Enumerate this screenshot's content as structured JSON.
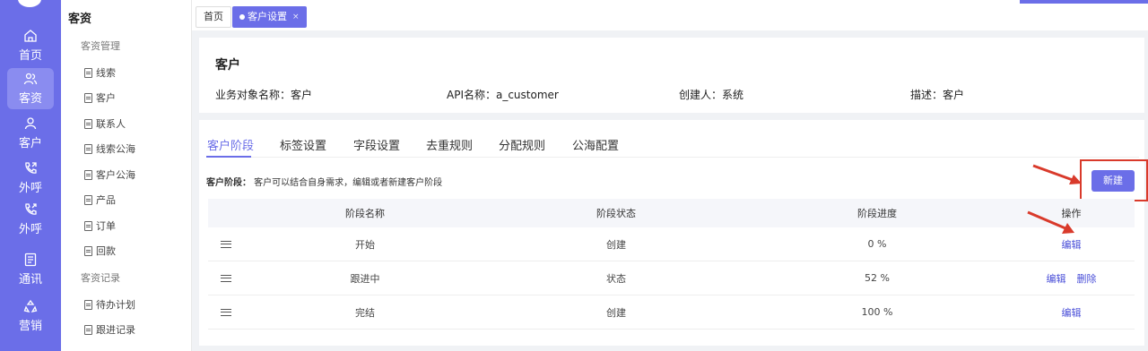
{
  "colors": {
    "brand": "#6b6ee8",
    "highlight_red": "#d93a2b",
    "link": "#4a4fd8"
  },
  "rail": {
    "items": [
      {
        "label": "首页",
        "icon": "home-icon",
        "active": false
      },
      {
        "label": "客资",
        "icon": "users-icon",
        "active": true
      },
      {
        "label": "客户",
        "icon": "user-icon",
        "active": false
      },
      {
        "label": "外呼",
        "icon": "phone-out-icon",
        "active": false
      },
      {
        "label": "外呼",
        "icon": "phone-forward-icon",
        "active": false
      },
      {
        "label": "通讯",
        "icon": "contacts-icon",
        "active": false
      },
      {
        "label": "营销",
        "icon": "recycle-icon",
        "active": false
      }
    ]
  },
  "sidebar": {
    "title": "客资",
    "group1": "客资管理",
    "items1": [
      "线索",
      "客户",
      "联系人",
      "线索公海",
      "客户公海",
      "产品",
      "订单",
      "回款"
    ],
    "group2": "客资记录",
    "items2": [
      "待办计划",
      "跟进记录"
    ]
  },
  "tabs": {
    "home": "首页",
    "active": "客户设置",
    "close": "×"
  },
  "object": {
    "title": "客户",
    "name_label": "业务对象名称：客户",
    "api_label": "API名称：a_customer",
    "creator_label": "创建人：系统",
    "desc_label": "描述：客户"
  },
  "subtabs": [
    "客户阶段",
    "标签设置",
    "字段设置",
    "去重规则",
    "分配规则",
    "公海配置"
  ],
  "stage": {
    "desc_bold": "客户阶段：",
    "desc_text": " 客户可以结合自身需求，编辑或者新建客户阶段",
    "new_button": "新建"
  },
  "table": {
    "headers": [
      "阶段名称",
      "阶段状态",
      "阶段进度",
      "操作"
    ],
    "rows": [
      {
        "name": "开始",
        "status": "创建",
        "progress": "0 %",
        "actions": [
          "编辑"
        ]
      },
      {
        "name": "跟进中",
        "status": "状态",
        "progress": "52 %",
        "actions": [
          "编辑",
          "删除"
        ]
      },
      {
        "name": "完结",
        "status": "创建",
        "progress": "100 %",
        "actions": [
          "编辑"
        ]
      }
    ]
  }
}
